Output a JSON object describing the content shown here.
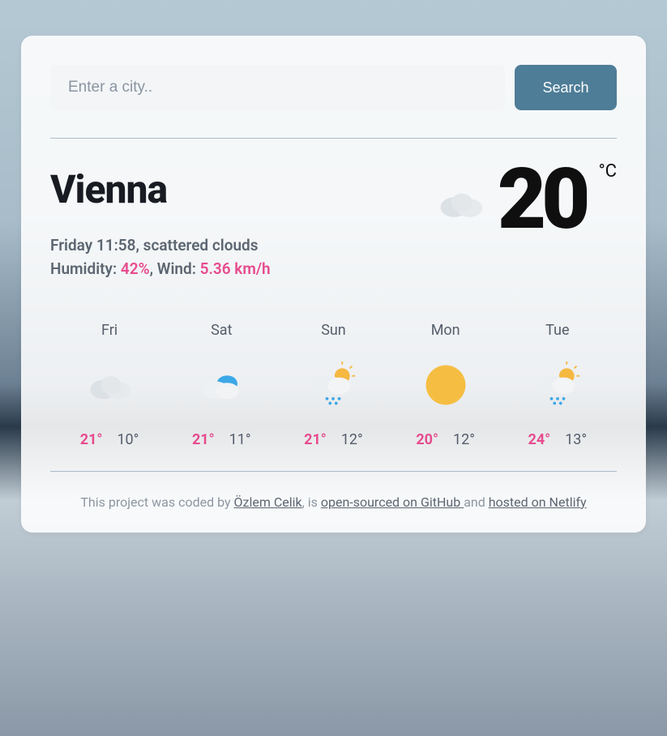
{
  "search": {
    "placeholder": "Enter a city..",
    "button": "Search"
  },
  "current": {
    "city": "Vienna",
    "dateline": "Friday 11:58, scattered clouds",
    "humidity_label": "Humidity: ",
    "humidity": "42%",
    "wind_label": ", Wind: ",
    "wind": "5.36 km/h",
    "temp": "20",
    "unit": "°C",
    "icon": "cloud"
  },
  "forecast": [
    {
      "day": "Fri",
      "icon": "cloud",
      "hi": "21°",
      "lo": "10°"
    },
    {
      "day": "Sat",
      "icon": "cloud-blue",
      "hi": "21°",
      "lo": "11°"
    },
    {
      "day": "Sun",
      "icon": "sun-cloud-rain",
      "hi": "21°",
      "lo": "12°"
    },
    {
      "day": "Mon",
      "icon": "sun",
      "hi": "20°",
      "lo": "12°"
    },
    {
      "day": "Tue",
      "icon": "sun-cloud-rain",
      "hi": "24°",
      "lo": "13°"
    }
  ],
  "footer": {
    "pre": "This project was coded by ",
    "author": "Özlem Celik",
    "mid1": ", is ",
    "link1": "open-sourced on GitHub ",
    "mid2": "and ",
    "link2": "hosted on Netlify"
  }
}
